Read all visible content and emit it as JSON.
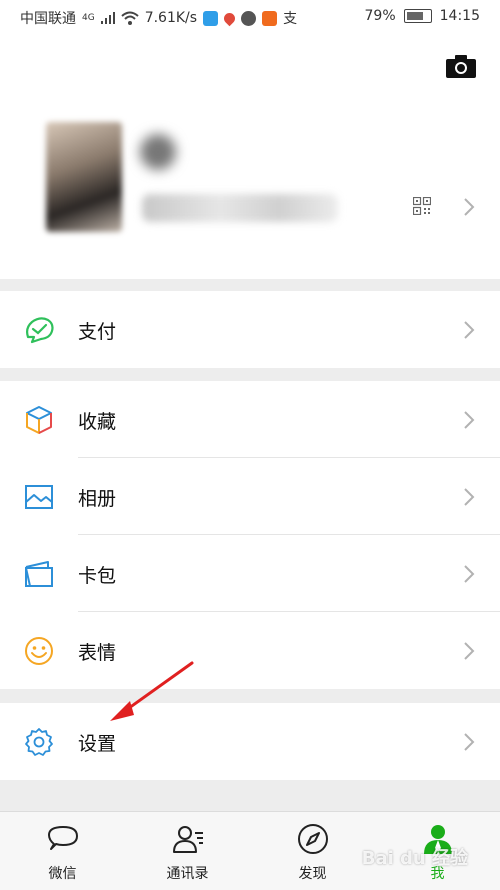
{
  "status_bar": {
    "carrier": "中国联通",
    "network": "4G",
    "speed": "7.61K/s",
    "battery": "79%",
    "time": "14:15",
    "app_icons": [
      "notification-blue-icon",
      "map-pin-icon",
      "chat-icon",
      "taobao-icon",
      "alipay-icon"
    ]
  },
  "profile": {
    "nickname": "",
    "wechat_id": ""
  },
  "menu": {
    "pay": {
      "label": "支付"
    },
    "items": [
      {
        "label": "收藏",
        "icon": "favorites-cube-icon"
      },
      {
        "label": "相册",
        "icon": "album-icon"
      },
      {
        "label": "卡包",
        "icon": "card-wallet-icon"
      },
      {
        "label": "表情",
        "icon": "emoji-icon"
      }
    ],
    "settings": {
      "label": "设置"
    }
  },
  "tabbar": {
    "tabs": [
      {
        "label": "微信",
        "icon": "chat-bubble-icon"
      },
      {
        "label": "通讯录",
        "icon": "contacts-icon"
      },
      {
        "label": "发现",
        "icon": "compass-icon"
      },
      {
        "label": "我",
        "icon": "me-person-icon",
        "active": true
      }
    ]
  },
  "watermark": "Bai du 经验",
  "colors": {
    "accent_green": "#1aad19",
    "pay_green": "#2fc05b",
    "blue_icon": "#2c8fd8",
    "emoji_orange": "#f5a623",
    "annotation_red": "#e02020"
  }
}
